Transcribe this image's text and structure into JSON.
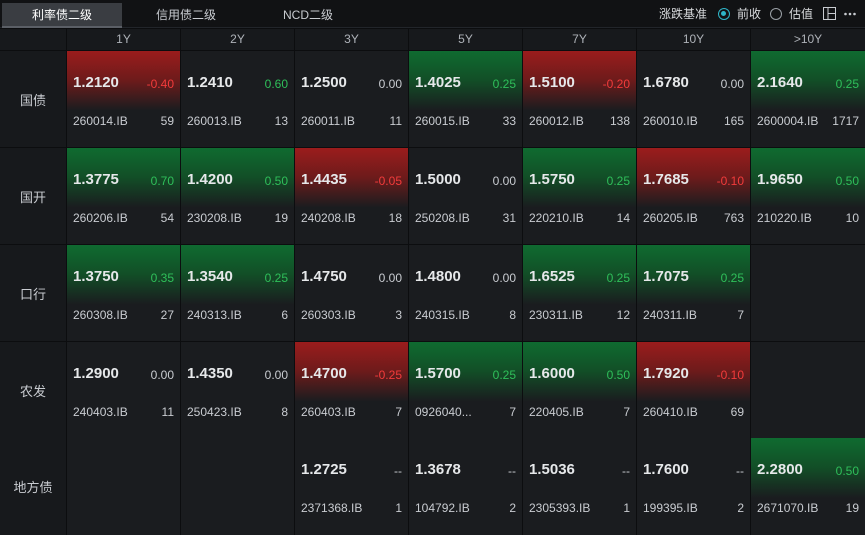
{
  "tabs": [
    {
      "label": "利率债二级",
      "active": true
    },
    {
      "label": "信用债二级",
      "active": false
    },
    {
      "label": "NCD二级",
      "active": false
    }
  ],
  "toolbar": {
    "basis_label": "涨跌基准",
    "option_prev_close": "前收",
    "option_valuation": "估值",
    "selected": "前收",
    "layout_icon": "layout-icon",
    "more_icon": "more-icon"
  },
  "colors": {
    "up": "#0f6b30",
    "down": "#9b1c1c",
    "pos_text": "#2fbf5a",
    "neg_text": "#f23b3b",
    "accent": "#2fb6c8"
  },
  "columns": [
    "1Y",
    "2Y",
    "3Y",
    "5Y",
    "7Y",
    "10Y",
    ">10Y"
  ],
  "rows": [
    {
      "name": "国债",
      "cells": [
        {
          "yield": "1.2120",
          "change": "-0.40",
          "code": "260014.IB",
          "count": "59",
          "trend": "down"
        },
        {
          "yield": "1.2410",
          "change": "0.60",
          "code": "260013.IB",
          "count": "13",
          "trend": "none"
        },
        {
          "yield": "1.2500",
          "change": "0.00",
          "code": "260011.IB",
          "count": "11",
          "trend": "none"
        },
        {
          "yield": "1.4025",
          "change": "0.25",
          "code": "260015.IB",
          "count": "33",
          "trend": "up"
        },
        {
          "yield": "1.5100",
          "change": "-0.20",
          "code": "260012.IB",
          "count": "138",
          "trend": "down"
        },
        {
          "yield": "1.6780",
          "change": "0.00",
          "code": "260010.IB",
          "count": "165",
          "trend": "none"
        },
        {
          "yield": "2.1640",
          "change": "0.25",
          "code": "2600004.IB",
          "count": "1717",
          "trend": "up"
        }
      ]
    },
    {
      "name": "国开",
      "cells": [
        {
          "yield": "1.3775",
          "change": "0.70",
          "code": "260206.IB",
          "count": "54",
          "trend": "up"
        },
        {
          "yield": "1.4200",
          "change": "0.50",
          "code": "230208.IB",
          "count": "19",
          "trend": "up"
        },
        {
          "yield": "1.4435",
          "change": "-0.05",
          "code": "240208.IB",
          "count": "18",
          "trend": "down"
        },
        {
          "yield": "1.5000",
          "change": "0.00",
          "code": "250208.IB",
          "count": "31",
          "trend": "none"
        },
        {
          "yield": "1.5750",
          "change": "0.25",
          "code": "220210.IB",
          "count": "14",
          "trend": "up"
        },
        {
          "yield": "1.7685",
          "change": "-0.10",
          "code": "260205.IB",
          "count": "763",
          "trend": "down"
        },
        {
          "yield": "1.9650",
          "change": "0.50",
          "code": "210220.IB",
          "count": "10",
          "trend": "up"
        }
      ]
    },
    {
      "name": "口行",
      "cells": [
        {
          "yield": "1.3750",
          "change": "0.35",
          "code": "260308.IB",
          "count": "27",
          "trend": "up"
        },
        {
          "yield": "1.3540",
          "change": "0.25",
          "code": "240313.IB",
          "count": "6",
          "trend": "up"
        },
        {
          "yield": "1.4750",
          "change": "0.00",
          "code": "260303.IB",
          "count": "3",
          "trend": "none"
        },
        {
          "yield": "1.4800",
          "change": "0.00",
          "code": "240315.IB",
          "count": "8",
          "trend": "none"
        },
        {
          "yield": "1.6525",
          "change": "0.25",
          "code": "230311.IB",
          "count": "12",
          "trend": "up"
        },
        {
          "yield": "1.7075",
          "change": "0.25",
          "code": "240311.IB",
          "count": "7",
          "trend": "up"
        },
        null
      ]
    },
    {
      "name": "农发",
      "cells": [
        {
          "yield": "1.2900",
          "change": "0.00",
          "code": "240403.IB",
          "count": "11",
          "trend": "none"
        },
        {
          "yield": "1.4350",
          "change": "0.00",
          "code": "250423.IB",
          "count": "8",
          "trend": "none"
        },
        {
          "yield": "1.4700",
          "change": "-0.25",
          "code": "260403.IB",
          "count": "7",
          "trend": "down"
        },
        {
          "yield": "1.5700",
          "change": "0.25",
          "code": "0926040...",
          "count": "7",
          "trend": "up"
        },
        {
          "yield": "1.6000",
          "change": "0.50",
          "code": "220405.IB",
          "count": "7",
          "trend": "up"
        },
        {
          "yield": "1.7920",
          "change": "-0.10",
          "code": "260410.IB",
          "count": "69",
          "trend": "down"
        },
        null
      ]
    },
    {
      "name": "地方债",
      "cells": [
        null,
        null,
        {
          "yield": "1.2725",
          "change": "--",
          "code": "2371368.IB",
          "count": "1",
          "trend": "none"
        },
        {
          "yield": "1.3678",
          "change": "--",
          "code": "104792.IB",
          "count": "2",
          "trend": "none"
        },
        {
          "yield": "1.5036",
          "change": "--",
          "code": "2305393.IB",
          "count": "1",
          "trend": "none"
        },
        {
          "yield": "1.7600",
          "change": "--",
          "code": "199395.IB",
          "count": "2",
          "trend": "none"
        },
        {
          "yield": "2.2800",
          "change": "0.50",
          "code": "2671070.IB",
          "count": "19",
          "trend": "up"
        }
      ]
    }
  ]
}
